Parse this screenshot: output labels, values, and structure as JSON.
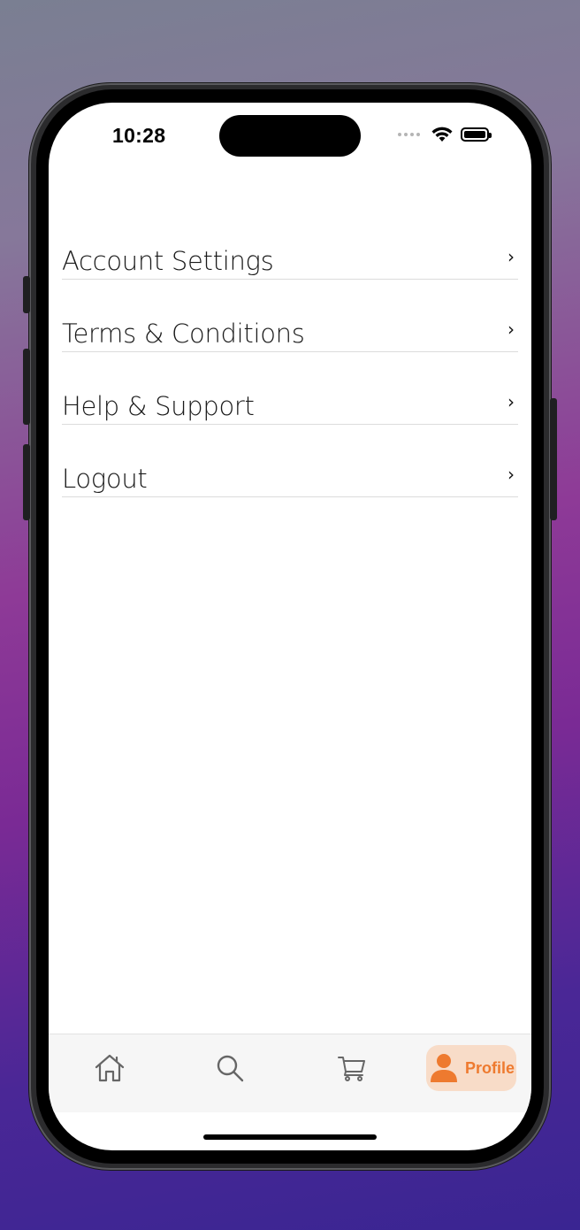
{
  "status_bar": {
    "time": "10:28"
  },
  "menu": {
    "items": [
      {
        "label": "Account Settings",
        "chevron": "›"
      },
      {
        "label": "Terms & Conditions",
        "chevron": "›"
      },
      {
        "label": "Help & Support",
        "chevron": "›"
      },
      {
        "label": "Logout",
        "chevron": "›"
      }
    ]
  },
  "tabbar": {
    "tabs": [
      {
        "icon": "home-icon"
      },
      {
        "icon": "search-icon"
      },
      {
        "icon": "cart-icon"
      },
      {
        "icon": "person-icon",
        "label": "Profile",
        "active": true
      }
    ],
    "accent_color": "#ee7a2f",
    "active_bg": "#f8dcc8"
  }
}
